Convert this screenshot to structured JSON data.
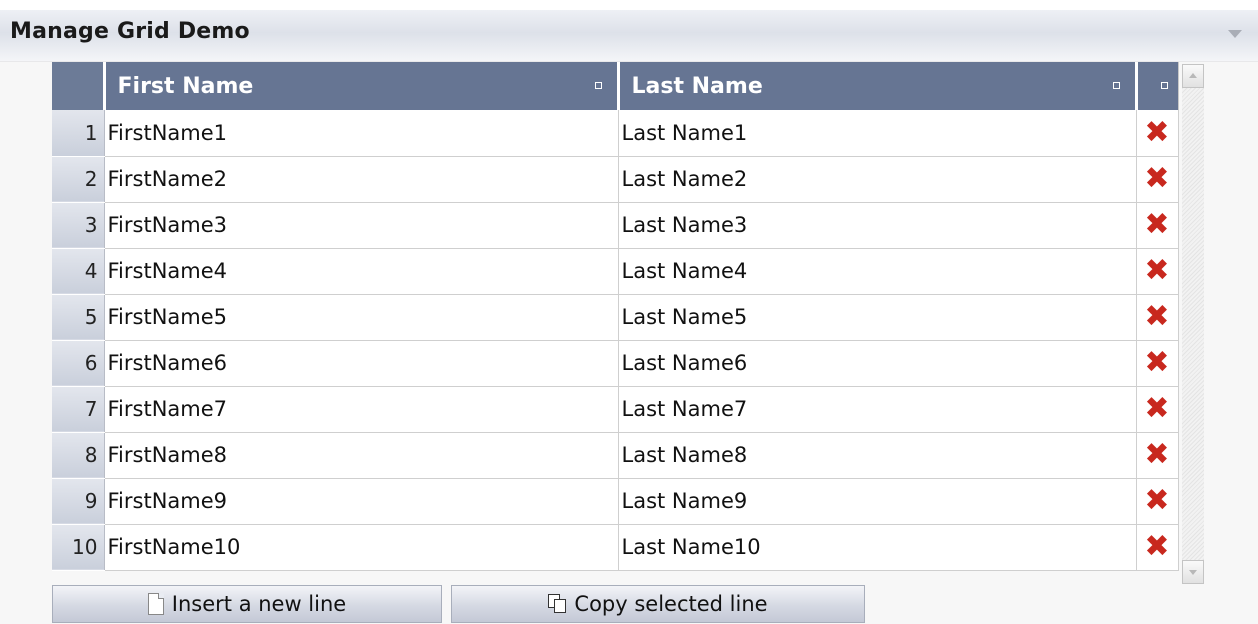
{
  "window": {
    "title": "Manage Grid Demo"
  },
  "grid": {
    "columns": {
      "first_name": "First Name",
      "last_name": "Last Name"
    },
    "rows": [
      {
        "num": "1",
        "first": "FirstName1",
        "last": "Last Name1"
      },
      {
        "num": "2",
        "first": "FirstName2",
        "last": "Last Name2"
      },
      {
        "num": "3",
        "first": "FirstName3",
        "last": "Last Name3"
      },
      {
        "num": "4",
        "first": "FirstName4",
        "last": "Last Name4"
      },
      {
        "num": "5",
        "first": "FirstName5",
        "last": "Last Name5"
      },
      {
        "num": "6",
        "first": "FirstName6",
        "last": "Last Name6"
      },
      {
        "num": "7",
        "first": "FirstName7",
        "last": "Last Name7"
      },
      {
        "num": "8",
        "first": "FirstName8",
        "last": "Last Name8"
      },
      {
        "num": "9",
        "first": "FirstName9",
        "last": "Last Name9"
      },
      {
        "num": "10",
        "first": "FirstName10",
        "last": "Last Name10"
      }
    ],
    "delete_glyph": "✖"
  },
  "buttons": {
    "insert_label": "Insert a new line",
    "copy_label": "Copy selected line"
  },
  "colors": {
    "header_bg": "#667593",
    "delete_icon": "#c8281e"
  },
  "icons": {
    "collapse": "chevron-down-icon",
    "sort": "sort-indicator-icon",
    "delete": "delete-x-icon",
    "insert": "new-document-icon",
    "copy": "copy-icon"
  }
}
